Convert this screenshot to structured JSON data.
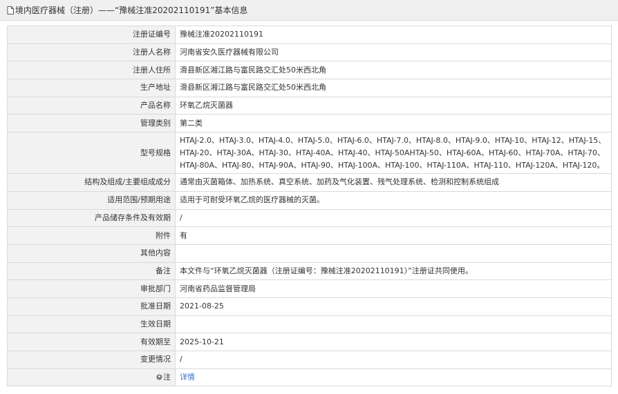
{
  "header": {
    "title": "境内医疗器械（注册）——“豫械注准20202110191”基本信息"
  },
  "rows": [
    {
      "label": "注册证编号",
      "value": "豫械注准20202110191"
    },
    {
      "label": "注册人名称",
      "value": "河南省安久医疗器械有限公司"
    },
    {
      "label": "注册人住所",
      "value": "滑县新区湘江路与富民路交汇处50米西北角"
    },
    {
      "label": "生产地址",
      "value": "滑县新区湘江路与富民路交汇处50米西北角"
    },
    {
      "label": "产品名称",
      "value": "环氧乙烷灭菌器"
    },
    {
      "label": "管理类别",
      "value": "第二类"
    },
    {
      "label": "型号规格",
      "value": "HTAJ-2.0、HTAJ-3.0、HTAJ-4.0、HTAJ-5.0、HTAJ-6.0、HTAJ-7.0、HTAJ-8.0、HTAJ-9.0、HTAJ-10、HTAJ-12、HTAJ-15、HTAJ-20、HTAJ-30A、HTAJ-30、HTAJ-40A、HTAJ-40、HTAJ-50AHTAJ-50、HTAJ-60A、HTAJ-60、HTAJ-70A、HTAJ-70、HTAJ-80A、HTAJ-80、HTAJ-90A、HTAJ-90、HTAJ-100A、HTAJ-100、HTAJ-110A、HTAJ-110、HTAJ-120A、HTAJ-120。"
    },
    {
      "label": "结构及组成/主要组成成分",
      "value": "通常由灭菌箱体、加热系统、真空系统、加药及气化装置、残气处理系统、检测和控制系统组成"
    },
    {
      "label": "适用范围/预期用途",
      "value": "适用于可耐受环氧乙烷的医疗器械的灭菌。"
    },
    {
      "label": "产品储存条件及有效期",
      "value": "/"
    },
    {
      "label": "附件",
      "value": "有"
    },
    {
      "label": "其他内容",
      "value": ""
    },
    {
      "label": "备注",
      "value": "本文件与“环氧乙烷灭菌器（注册证编号：豫械注准20202110191）”注册证共同使用。"
    },
    {
      "label": "审批部门",
      "value": "河南省药品监督管理局"
    },
    {
      "label": "批准日期",
      "value": "2021-08-25"
    },
    {
      "label": "生效日期",
      "value": ""
    },
    {
      "label": "有效期至",
      "value": "2025-10-21"
    },
    {
      "label": "变更情况",
      "value": "/"
    }
  ],
  "note": {
    "icon": "location-pin-icon",
    "label": "注",
    "link_text": "详情",
    "link_color": "#3a6fc4"
  }
}
